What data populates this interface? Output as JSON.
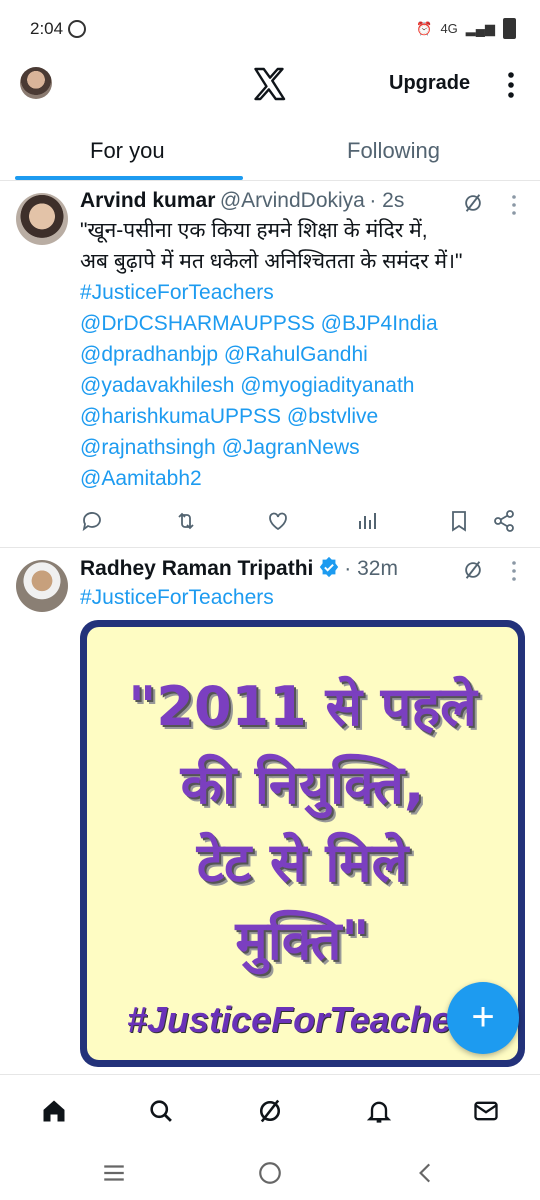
{
  "status_bar": {
    "time": "2:04",
    "network": "4G"
  },
  "header": {
    "upgrade_label": "Upgrade"
  },
  "tabs": [
    {
      "label": "For you"
    },
    {
      "label": "Following"
    }
  ],
  "tweets": [
    {
      "name": "Arvind kumar",
      "handle": "@ArvindDokiya",
      "time": "· 2s",
      "lines": [
        {
          "text": "\"खून-पसीना एक किया हमने शिक्षा के मंदिर में,",
          "link": false
        },
        {
          "text": "अब बुढ़ापे में मत धकेलो अनिश्चितता के समंदर में।\"",
          "link": false
        },
        {
          "text": "#JusticeForTeachers",
          "link": true
        },
        {
          "text": "@DrDCSHARMAUPPSS @BJP4India",
          "link": true
        },
        {
          "text": "@dpradhanbjp @RahulGandhi",
          "link": true
        },
        {
          "text": "@yadavakhilesh @myogiadityanath",
          "link": true
        },
        {
          "text": "@harishkumaUPPSS @bstvlive",
          "link": true
        },
        {
          "text": "@rajnathsingh @JagranNews",
          "link": true
        },
        {
          "text": "@Aamitabh2",
          "link": true
        }
      ]
    },
    {
      "name": "Radhey Raman Tripathi",
      "handle": "",
      "time": "· 32m",
      "lines": [
        {
          "text": "#JusticeForTeachers",
          "link": true
        }
      ],
      "image_text": {
        "line1": "\"2011 से पहले",
        "line2": "की नियुक्ति,",
        "line3": "टेट से मिले",
        "line4": "मुक्ति\"",
        "hashtag": "#JusticeForTeachers"
      }
    }
  ],
  "fab_label": "+",
  "colors": {
    "accent": "#1d9bf0",
    "poster_bg": "#fefcc3",
    "poster_border": "#23327a",
    "poster_text": "#7b3fc0"
  }
}
